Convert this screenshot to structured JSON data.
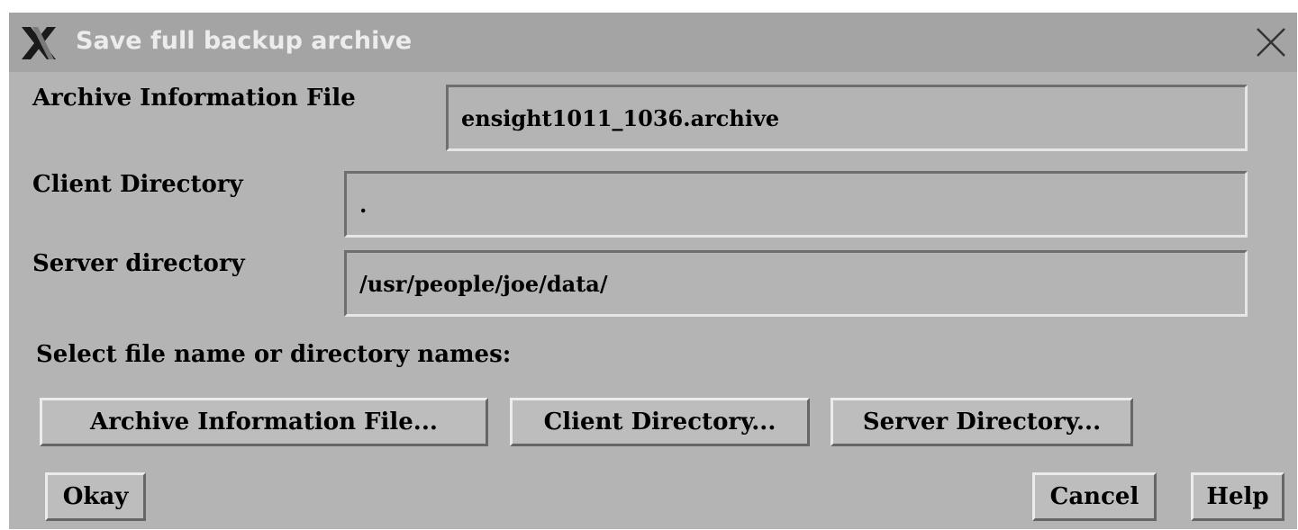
{
  "window": {
    "title": "Save full backup archive"
  },
  "fields": {
    "archive_info_label": "Archive Information File",
    "archive_info_value": "ensight1011_1036.archive",
    "client_dir_label": "Client Directory",
    "client_dir_value": ".",
    "server_dir_label": "Server directory",
    "server_dir_value": "/usr/people/joe/data/"
  },
  "select_prompt": "Select file name or directory names:",
  "browse_buttons": {
    "archive_info": "Archive Information File...",
    "client_dir": "Client Directory...",
    "server_dir": "Server Directory..."
  },
  "actions": {
    "okay": "Okay",
    "cancel": "Cancel",
    "help": "Help"
  },
  "icons": {
    "window_logo": "x-window-logo-icon",
    "close": "close-icon"
  }
}
